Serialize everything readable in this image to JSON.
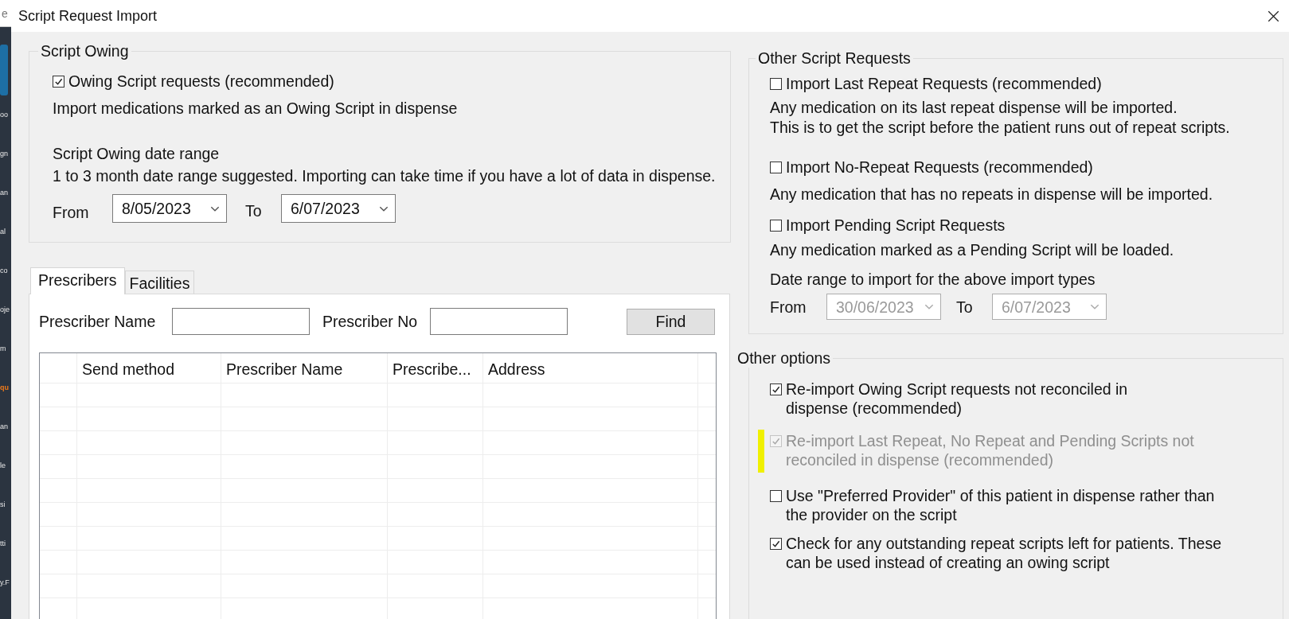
{
  "background_window": {
    "search_fragment": "e",
    "items": [
      {
        "label": "oo",
        "selected": false
      },
      {
        "label": "gn",
        "selected": false
      },
      {
        "label": "an",
        "selected": false
      },
      {
        "label": "al",
        "selected": false
      },
      {
        "label": "co",
        "selected": false
      },
      {
        "label": "oje",
        "selected": false
      },
      {
        "label": "m",
        "selected": false
      },
      {
        "label": "qu",
        "selected": true
      },
      {
        "label": "an",
        "selected": false
      },
      {
        "label": "le",
        "selected": false
      },
      {
        "label": "si",
        "selected": false
      },
      {
        "label": "tti",
        "selected": false
      },
      {
        "label": "y.F",
        "selected": false
      }
    ]
  },
  "window": {
    "title": "Script Request Import"
  },
  "script_owing": {
    "title": "Script Owing",
    "option": {
      "label": "Owing Script requests (recommended)",
      "checked": true
    },
    "description": "Import medications marked as an Owing Script in dispense",
    "date_range_title": "Script Owing date range",
    "date_range_hint": "1 to 3 month date range suggested. Importing can take time if you have a lot of data in dispense.",
    "from_label": "From",
    "from_value": "8/05/2023",
    "to_label": "To",
    "to_value": "6/07/2023",
    "disabled": false
  },
  "tabs": [
    {
      "label": "Prescribers",
      "selected": true
    },
    {
      "label": "Facilities",
      "selected": false
    }
  ],
  "search": {
    "name_label": "Prescriber Name",
    "number_label": "Prescriber No",
    "find_button": "Find"
  },
  "table": {
    "columns": [
      "Send method",
      "Prescriber Name",
      "Prescribe...",
      "Address"
    ]
  },
  "other_requests": {
    "title": "Other Script Requests",
    "options": [
      {
        "label": "Import Last Repeat Requests (recommended)",
        "checked": false,
        "description": [
          "Any medication on its last repeat dispense will be imported.",
          "This is to get the script before the patient runs out of repeat scripts."
        ]
      },
      {
        "label": "Import No-Repeat Requests (recommended)",
        "checked": false,
        "description": [
          "Any medication that has no repeats in dispense will be imported."
        ]
      },
      {
        "label": "Import Pending Script Requests",
        "checked": false,
        "description": [
          "Any medication marked as a Pending Script will be loaded."
        ]
      }
    ],
    "date_range_title": "Date range to import for the above import types",
    "from_label": "From",
    "from_value": "30/06/2023",
    "to_label": "To",
    "to_value": "6/07/2023",
    "disabled": true
  },
  "other_options": {
    "title": "Other options",
    "options": [
      {
        "label_lines": [
          "Re-import Owing Script requests not reconciled in",
          "dispense (recommended)"
        ],
        "checked": true,
        "disabled": false,
        "highlighted": false
      },
      {
        "label_lines": [
          "Re-import Last Repeat, No Repeat and Pending Scripts not",
          "reconciled in dispense (recommended)"
        ],
        "checked": true,
        "disabled": true,
        "highlighted": true
      },
      {
        "label_lines": [
          "Use \"Preferred Provider\" of this patient in dispense rather than",
          "the provider on the script"
        ],
        "checked": false,
        "disabled": false,
        "highlighted": false
      },
      {
        "label_lines": [
          "Check for any outstanding repeat scripts left for patients. These",
          "can be used instead of creating an owing script"
        ],
        "checked": true,
        "disabled": false,
        "highlighted": false
      }
    ]
  }
}
